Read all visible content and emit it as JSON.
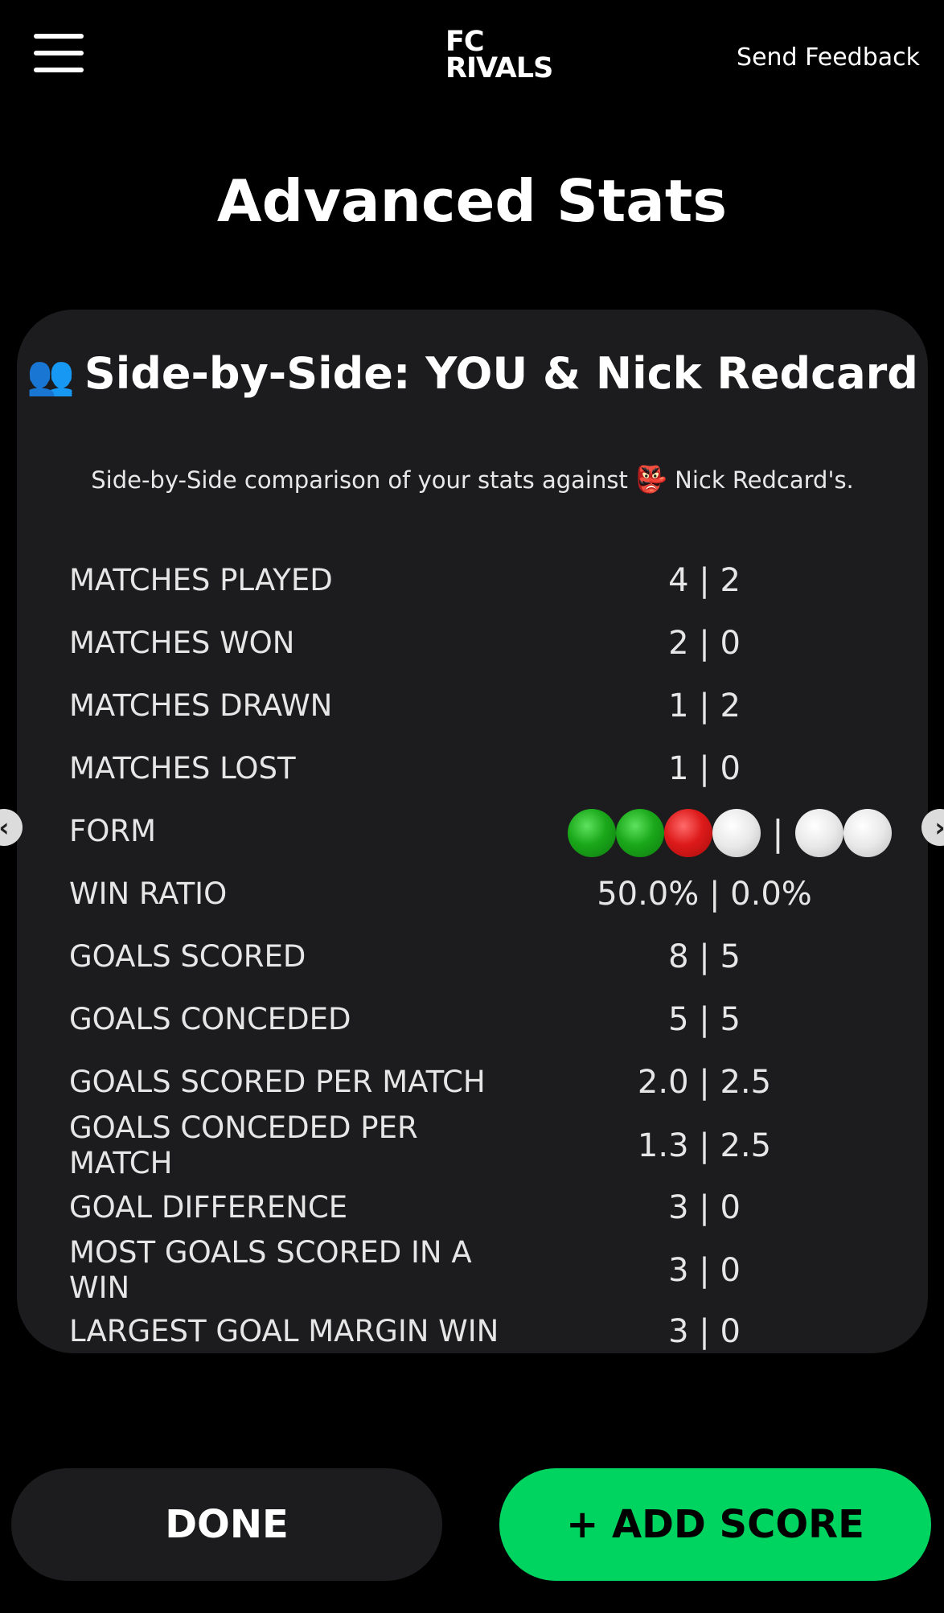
{
  "header": {
    "logo_line1": "FC",
    "logo_line2": "RIVALS",
    "feedback_label": "Send Feedback"
  },
  "page": {
    "title": "Advanced Stats"
  },
  "card": {
    "title_emoji": "👥",
    "title": "Side-by-Side: YOU & Nick Redcard",
    "desc_before": "Side-by-Side comparison of your stats against ",
    "desc_emoji": "👺",
    "desc_after": " Nick Redcard's."
  },
  "stats": [
    {
      "label": "MATCHES PLAYED",
      "value": "4 | 2"
    },
    {
      "label": "MATCHES WON",
      "value": "2 | 0"
    },
    {
      "label": "MATCHES DRAWN",
      "value": "1 | 2"
    },
    {
      "label": "MATCHES LOST",
      "value": "1 | 0"
    },
    {
      "label": "FORM",
      "value": ""
    },
    {
      "label": "WIN RATIO",
      "value": "50.0% | 0.0%"
    },
    {
      "label": "GOALS SCORED",
      "value": "8 | 5"
    },
    {
      "label": "GOALS CONCEDED",
      "value": "5 | 5"
    },
    {
      "label": "GOALS SCORED PER MATCH",
      "value": "2.0 | 2.5"
    },
    {
      "label": "GOALS CONCEDED PER MATCH",
      "value": "1.3 | 2.5"
    },
    {
      "label": "GOAL DIFFERENCE",
      "value": "3 | 0"
    },
    {
      "label": "MOST GOALS SCORED IN A WIN",
      "value": "3 | 0"
    },
    {
      "label": "LARGEST GOAL MARGIN WIN",
      "value": "3 | 0"
    }
  ],
  "form": {
    "you": [
      "win",
      "win",
      "loss",
      "none"
    ],
    "separator": "|",
    "rival": [
      "none",
      "none"
    ],
    "colors": {
      "win": "#1aa81a",
      "loss": "#dd1a1a",
      "none": "#e8e8e8"
    }
  },
  "nav": {
    "prev_icon": "chevron-left-icon",
    "prev_glyph": "‹",
    "next_icon": "chevron-right-icon",
    "next_glyph": "›"
  },
  "buttons": {
    "done_label": "DONE",
    "add_label": "+ ADD SCORE"
  },
  "colors": {
    "background": "#000000",
    "card": "#1c1c1e",
    "accent": "#00d460"
  }
}
